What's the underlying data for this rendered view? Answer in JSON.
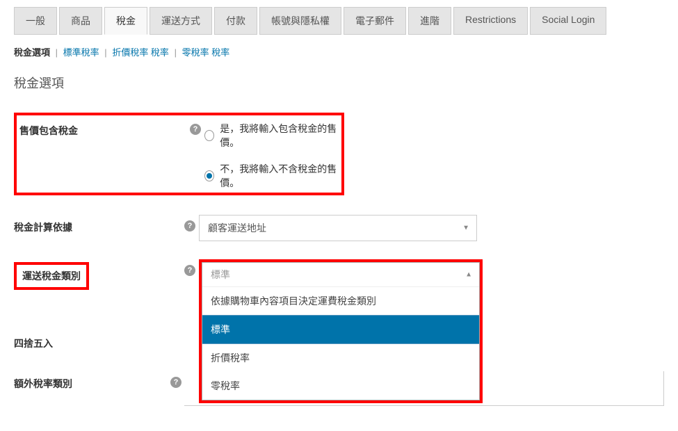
{
  "tabs": [
    {
      "label": "一般"
    },
    {
      "label": "商品"
    },
    {
      "label": "稅金"
    },
    {
      "label": "運送方式"
    },
    {
      "label": "付款"
    },
    {
      "label": "帳號與隱私權"
    },
    {
      "label": "電子郵件"
    },
    {
      "label": "進階"
    },
    {
      "label": "Restrictions"
    },
    {
      "label": "Social Login"
    }
  ],
  "subsections": {
    "current": "稅金選項",
    "links": [
      "標準稅率",
      "折價稅率 稅率",
      "零稅率 稅率"
    ]
  },
  "section_title": "稅金選項",
  "fields": {
    "price_with_tax": {
      "label": "售價包含稅金",
      "option_yes": "是，我將輸入包含稅金的售價。",
      "option_no": "不，我將輸入不含稅金的售價。"
    },
    "calc_basis": {
      "label": "稅金計算依據",
      "value": "顧客運送地址"
    },
    "shipping_tax_class": {
      "label": "運送稅金類別",
      "current": "標準",
      "options": [
        "依據購物車內容項目決定運費稅金類別",
        "標準",
        "折價稅率",
        "零稅率"
      ]
    },
    "rounding": {
      "label": "四捨五入"
    },
    "additional_classes": {
      "label": "額外稅率類別"
    }
  }
}
